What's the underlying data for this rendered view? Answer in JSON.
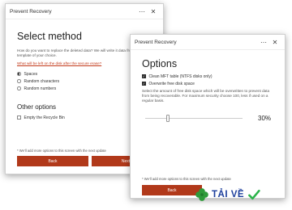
{
  "window1": {
    "title": "Prevent Recovery",
    "heading": "Select method",
    "description": "How do you want to replace the deleted data? We will write it data from the template of your choice.",
    "link": "What will be left on the disk after the secure erase?",
    "radios": [
      {
        "label": "Spaces",
        "checked": true
      },
      {
        "label": "Random characters",
        "checked": false
      },
      {
        "label": "Random numbers",
        "checked": false
      }
    ],
    "other_heading": "Other options",
    "checkbox": {
      "label": "Empty the Recycle Bin",
      "checked": false
    },
    "note": "* We'll add more options to this screen with the next update",
    "back_label": "Back",
    "next_label": "Next"
  },
  "window2": {
    "title": "Prevent Recovery",
    "heading": "Options",
    "checks": [
      {
        "label": "Clean MFT table (NTFS disks only)",
        "checked": true
      },
      {
        "label": "Overwrite free disk space",
        "checked": true
      }
    ],
    "description": "Select the amount of free disk space which will be overwritten to prevent data from being recoverable. For maximum security choose 100, less if used on a regular basis.",
    "slider_value": 0.3,
    "percent_label": "30%",
    "note": "* We'll add more options to this screen with the next update",
    "back_label": "Back"
  },
  "titlebar_icons": {
    "more": "⋯",
    "close": "✕"
  },
  "watermark": {
    "text": "TẢI VỀ",
    "icons": [
      "clover-icon",
      "checkmark-icon"
    ]
  },
  "colors": {
    "accent": "#b1391a",
    "link": "#c23a1b",
    "logo_blue": "#1d3f9c",
    "clover": "#2e9a3a",
    "tick": "#2bb34a"
  }
}
